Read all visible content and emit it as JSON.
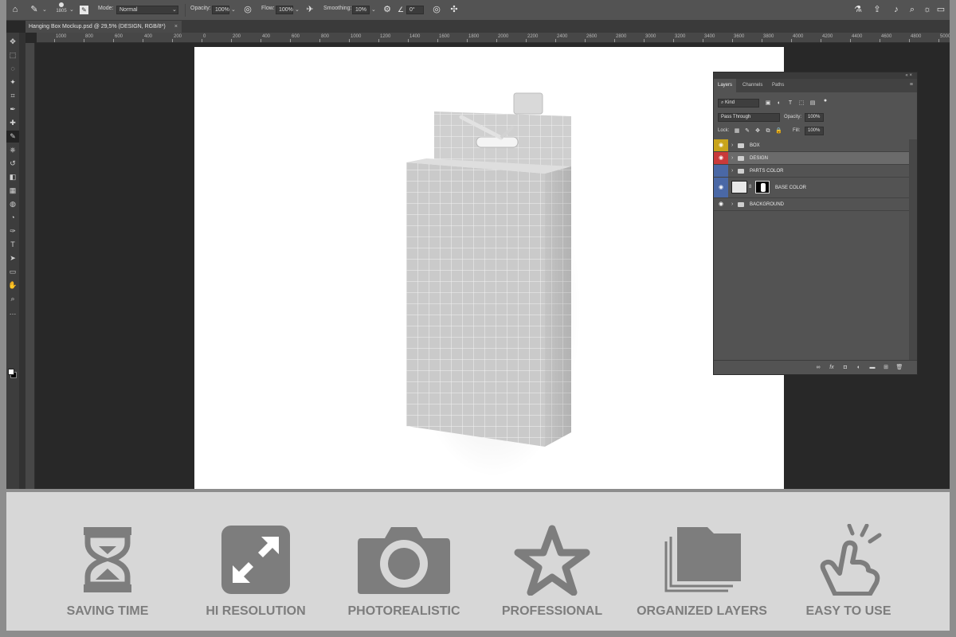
{
  "options_bar": {
    "brush_size": "1805",
    "mode_label": "Mode:",
    "mode_value": "Normal",
    "opacity_label": "Opacity:",
    "opacity_value": "100%",
    "flow_label": "Flow:",
    "flow_value": "100%",
    "smoothing_label": "Smoothing:",
    "smoothing_value": "10%",
    "angle_value": "0°"
  },
  "document_tab": {
    "title": "Hanging Box Mockup.psd @ 29,5% (DESIGN, RGB/8*)",
    "close": "×"
  },
  "ruler": {
    "ticks": [
      "1000",
      "800",
      "600",
      "400",
      "200",
      "0",
      "200",
      "400",
      "600",
      "800",
      "1000",
      "1200",
      "1400",
      "1600",
      "1800",
      "2000",
      "2200",
      "2400",
      "2600",
      "2800",
      "3000",
      "3200",
      "3400",
      "3600",
      "3800",
      "4000",
      "4200",
      "4400",
      "4600",
      "4800",
      "5000"
    ]
  },
  "layers_panel": {
    "collapse_glyph": "«  ×",
    "tabs": [
      "Layers",
      "Channels",
      "Paths"
    ],
    "filter_kind": "Kind",
    "blend_mode": "Pass Through",
    "opacity_label": "Opacity:",
    "opacity_value": "100%",
    "lock_label": "Lock:",
    "fill_label": "Fill:",
    "fill_value": "100%",
    "layers": [
      {
        "name": "BOX",
        "color": "#c9a41b",
        "visible": true,
        "type": "group"
      },
      {
        "name": "DESIGN",
        "color": "#c93a3a",
        "visible": true,
        "type": "group",
        "selected": true
      },
      {
        "name": "PARTS COLOR",
        "color": "#4a68a6",
        "visible": false,
        "type": "group"
      },
      {
        "name": "BASE COLOR",
        "color": "#4a68a6",
        "visible": true,
        "type": "layer"
      },
      {
        "name": "BACKGROUND",
        "color": "",
        "visible": true,
        "type": "group"
      }
    ]
  },
  "features": [
    {
      "label": "SAVING TIME",
      "icon": "hourglass-icon"
    },
    {
      "label": "HI RESOLUTION",
      "icon": "expand-arrows-icon"
    },
    {
      "label": "PHOTOREALISTIC",
      "icon": "camera-icon"
    },
    {
      "label": "PROFESSIONAL",
      "icon": "star-icon"
    },
    {
      "label": "ORGANIZED LAYERS",
      "icon": "layers-folder-icon"
    },
    {
      "label": "EASY TO USE",
      "icon": "pointing-hand-icon"
    }
  ],
  "colors": {
    "feature_gray": "#7d7d7d",
    "strip_bg": "#d7d7d7",
    "ps_dark": "#282828"
  }
}
